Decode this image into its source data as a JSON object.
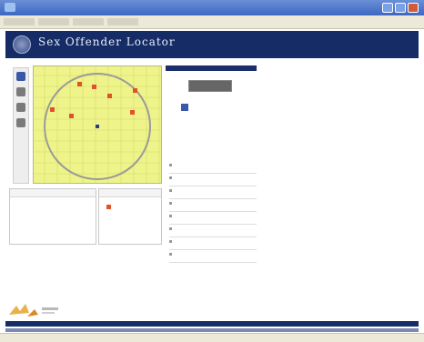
{
  "browser": {
    "title": "",
    "toolbar_items": [
      "",
      "",
      "",
      "",
      "",
      "",
      "",
      "",
      ""
    ]
  },
  "header": {
    "title": "Sex Offender Locator",
    "subtitle": ""
  },
  "colors": {
    "header_bg": "#162c66",
    "map_bg": "#eef48a",
    "marker_offender": "#e0532a",
    "marker_home": "#2a3c86"
  },
  "map_tools": [
    "zoom-in-icon",
    "zoom-out-icon",
    "pan-icon",
    "info-icon"
  ],
  "left_info": {
    "title": "",
    "text": ""
  },
  "legend": {
    "title": "",
    "text": ""
  },
  "search_panel": {
    "title": "",
    "button_label": "",
    "checkbox_label": "",
    "result_text": ""
  },
  "results": [
    {
      "name": "",
      "address": ""
    },
    {
      "name": "",
      "address": ""
    },
    {
      "name": "",
      "address": ""
    },
    {
      "name": "",
      "address": ""
    },
    {
      "name": "",
      "address": ""
    },
    {
      "name": "",
      "address": ""
    },
    {
      "name": "",
      "address": ""
    },
    {
      "name": "",
      "address": ""
    }
  ]
}
